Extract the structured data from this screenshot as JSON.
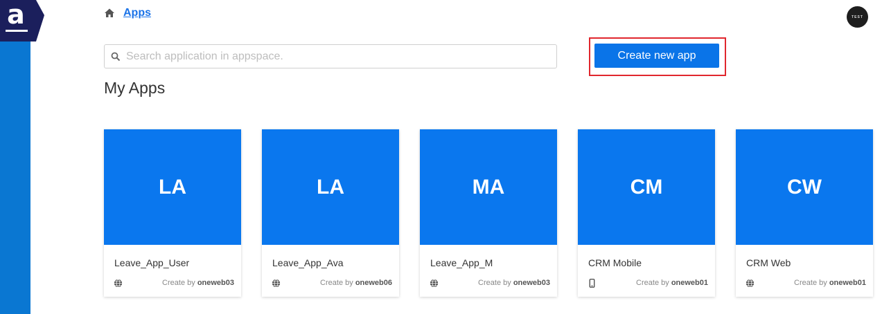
{
  "breadcrumb": {
    "current": "Apps"
  },
  "avatar": {
    "text": "TEST"
  },
  "search": {
    "placeholder": "Search application in appspace.",
    "value": ""
  },
  "actions": {
    "create_label": "Create new app"
  },
  "section": {
    "title": "My Apps"
  },
  "colors": {
    "sidebar": "#0a77d2",
    "tile": "#0a77ee",
    "button": "#0a74e8",
    "highlight": "#e0262d"
  },
  "apps": [
    {
      "initials": "LA",
      "name": "Leave_App_User",
      "created_prefix": "Create by",
      "creator": "oneweb03",
      "platform": "globe-icon"
    },
    {
      "initials": "LA",
      "name": "Leave_App_Ava",
      "created_prefix": "Create by",
      "creator": "oneweb06",
      "platform": "globe-icon"
    },
    {
      "initials": "MA",
      "name": "Leave_App_M",
      "created_prefix": "Create by",
      "creator": "oneweb03",
      "platform": "globe-icon"
    },
    {
      "initials": "CM",
      "name": "CRM Mobile",
      "created_prefix": "Create by",
      "creator": "oneweb01",
      "platform": "mobile-icon"
    },
    {
      "initials": "CW",
      "name": "CRM Web",
      "created_prefix": "Create by",
      "creator": "oneweb01",
      "platform": "globe-icon"
    }
  ]
}
